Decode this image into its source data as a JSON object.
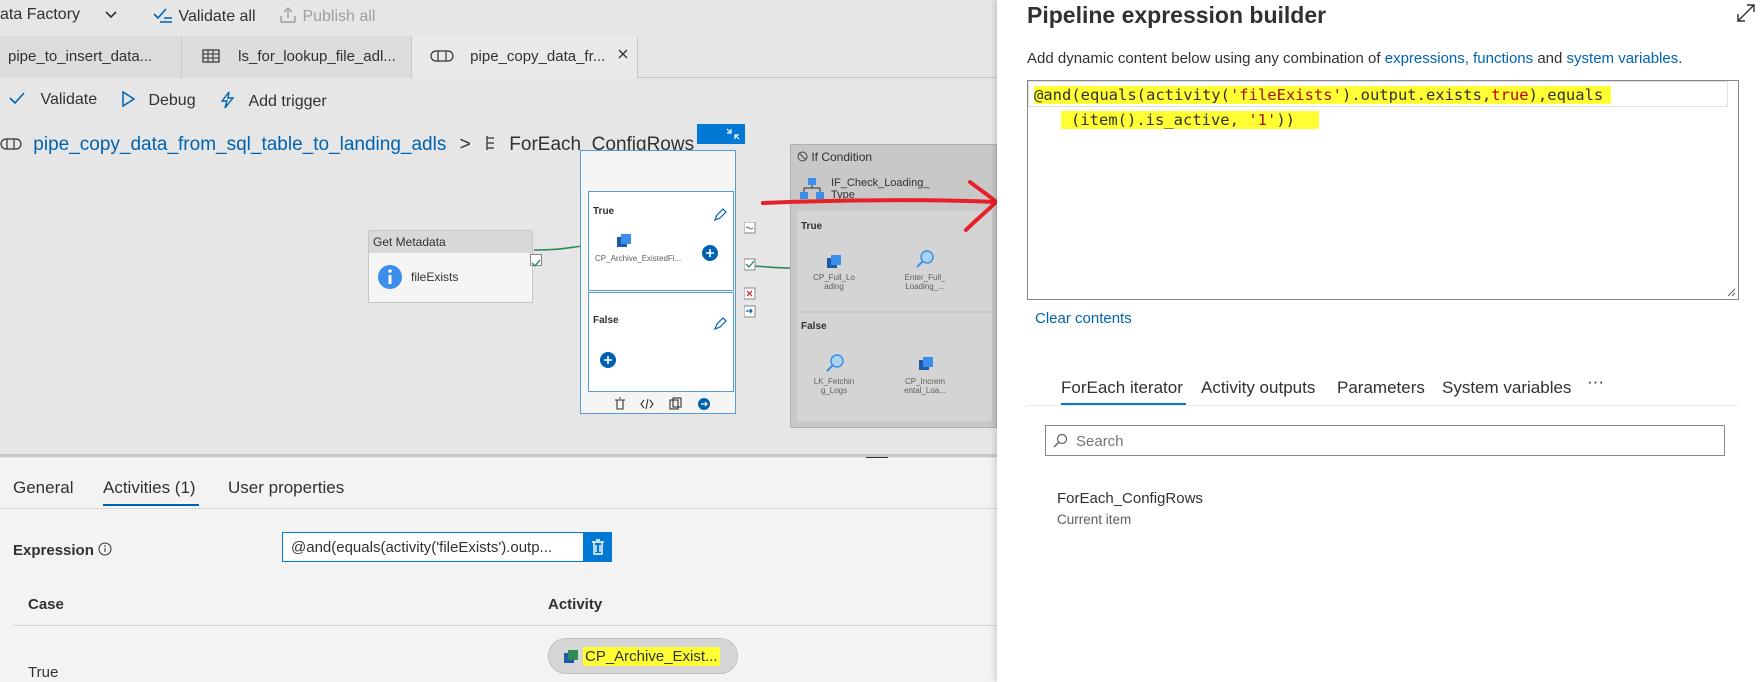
{
  "topbar": {
    "factory_label": "ata Factory",
    "validate_all": "Validate all",
    "publish_all": "Publish all"
  },
  "tabs": [
    {
      "label": "pipe_to_insert_data..."
    },
    {
      "label": "ls_for_lookup_file_adl..."
    },
    {
      "label": "pipe_copy_data_fr..."
    }
  ],
  "toolbar": {
    "validate": "Validate",
    "debug": "Debug",
    "add_trigger": "Add trigger"
  },
  "breadcrumb": {
    "pipeline": "pipe_copy_data_from_sql_table_to_landing_adls",
    "separator": ">",
    "current": "ForEach_ConfigRows"
  },
  "canvas": {
    "get_metadata": {
      "header": "Get Metadata",
      "activity": "fileExists"
    },
    "switch": {
      "true_label": "True",
      "false_label": "False",
      "true_activity": "CP_Archive_ExistedFi..."
    },
    "if_condition": {
      "header": "If Condition",
      "name": "IF_Check_Loading_ Type",
      "true_label": "True",
      "false_label": "False",
      "true_activities": [
        "CP_Full_Lo ading",
        "Enter_Full_ Loading_..."
      ],
      "false_activities": [
        "LK_Fetchin g_Logs",
        "CP_Increm ental_Loa..."
      ]
    }
  },
  "properties": {
    "tabs": [
      "General",
      "Activities (1)",
      "User properties"
    ],
    "expression_label": "Expression",
    "expression_value": "@and(equals(activity('fileExists').outp...",
    "case_header": "Case",
    "activity_header": "Activity",
    "row": {
      "case": "True",
      "activity": "CP_Archive_Exist..."
    }
  },
  "builder": {
    "title": "Pipeline expression builder",
    "intro_prefix": "Add dynamic content below using any combination of",
    "intro_link1": "expressions, functions",
    "intro_and": "and",
    "intro_link2": "system variables",
    "intro_suffix": ".",
    "expression": {
      "line1_p1": "@and(equals(activity(",
      "line1_str": "'fileExists'",
      "line1_p2": ").output.exists,",
      "line1_kw": "true",
      "line1_p3": "),equals",
      "line2_p1": "(item().is_active, ",
      "line2_str": "'1'",
      "line2_p2": "))"
    },
    "clear_contents": "Clear contents",
    "tabs": [
      "ForEach iterator",
      "Activity outputs",
      "Parameters",
      "System variables"
    ],
    "more": "···",
    "search_placeholder": "Search",
    "item": {
      "name": "ForEach_ConfigRows",
      "desc": "Current item"
    }
  },
  "colors": {
    "accent": "#0063b1",
    "highlight": "#ffff33",
    "arrow": "#e8202a",
    "keyword": "#c00000",
    "string": "#a31515"
  }
}
